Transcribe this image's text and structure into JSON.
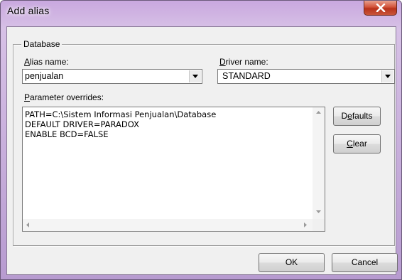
{
  "window": {
    "title": "Add alias",
    "close_icon": "close-x-icon"
  },
  "database_group": {
    "legend": "Database",
    "alias_label_prefix": "A",
    "alias_label_rest": "lias name:",
    "driver_label_prefix": "D",
    "driver_label_rest": "river name:",
    "alias_value": "penjualan",
    "driver_value": "STANDARD",
    "params_label_prefix": "P",
    "params_label_rest": "arameter overrides:",
    "params_lines": "PATH=C:\\Sistem Informasi Penjualan\\Database\nDEFAULT DRIVER=PARADOX\nENABLE BCD=FALSE"
  },
  "buttons": {
    "defaults_prefix": "D",
    "defaults_u": "e",
    "defaults_rest": "faults",
    "clear_u": "C",
    "clear_rest": "lear",
    "ok": "OK",
    "cancel": "Cancel"
  },
  "colors": {
    "title_gradient_top": "#c9a8df",
    "close_button": "#c8553a",
    "dialog_bg": "#f0f0f0"
  }
}
